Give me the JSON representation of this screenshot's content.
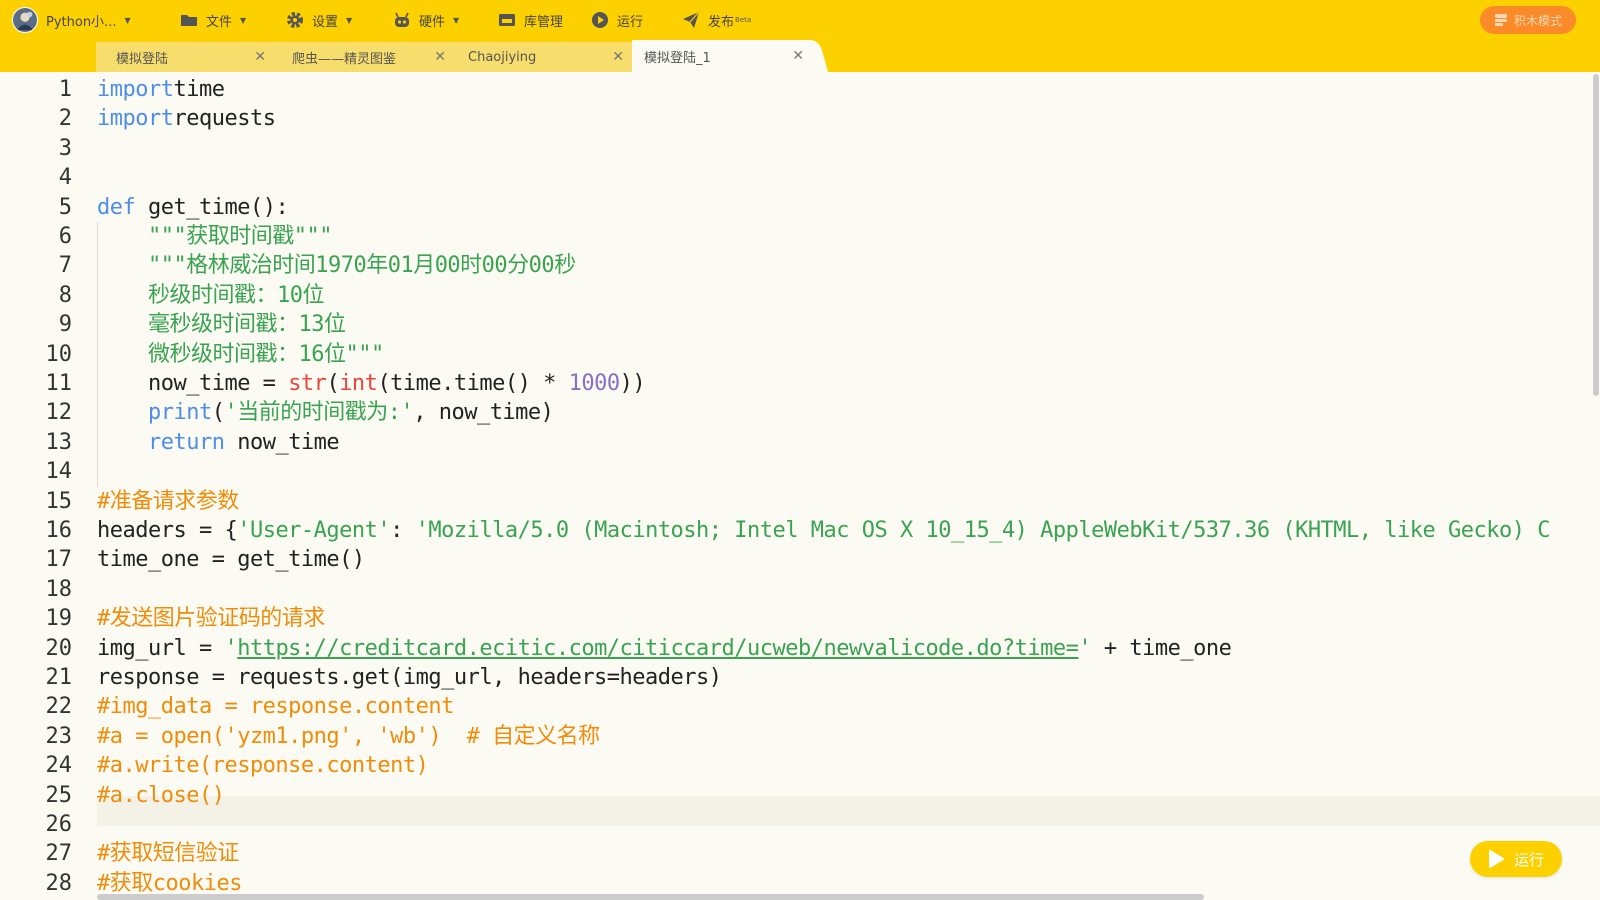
{
  "toolbar": {
    "project_label": "Python小...",
    "file_label": "文件",
    "settings_label": "设置",
    "hardware_label": "硬件",
    "library_label": "库管理",
    "run_label": "运行",
    "publish_label": "发布",
    "publish_badge": "Beta",
    "block_mode_label": "积木模式"
  },
  "tabs": [
    {
      "label": "模拟登陆",
      "active": false
    },
    {
      "label": "爬虫——精灵图鉴",
      "active": false
    },
    {
      "label": "Chaojiying",
      "active": false
    },
    {
      "label": "模拟登陆_1",
      "active": true
    }
  ],
  "editor": {
    "highlighted_line": 25,
    "line_numbers": [
      "1",
      "2",
      "3",
      "4",
      "5",
      "6",
      "7",
      "8",
      "9",
      "10",
      "11",
      "12",
      "13",
      "14",
      "15",
      "16",
      "17",
      "18",
      "19",
      "20",
      "21",
      "22",
      "23",
      "24",
      "25",
      "26",
      "27",
      "28"
    ],
    "lines": [
      [
        [
          "kw",
          "import"
        ],
        [
          "",
          "time"
        ]
      ],
      [
        [
          "kw",
          "import"
        ],
        [
          "",
          "requests"
        ]
      ],
      [],
      [],
      [
        [
          "kw",
          "def"
        ],
        [
          "",
          " get_time():"
        ]
      ],
      [
        [
          "",
          "    "
        ],
        [
          "str",
          "\"\"\"获取时间戳\"\"\""
        ]
      ],
      [
        [
          "",
          "    "
        ],
        [
          "str",
          "\"\"\"格林威治时间1970年01月00时00分00秒"
        ]
      ],
      [
        [
          "",
          "    "
        ],
        [
          "str",
          "秒级时间戳：10位"
        ]
      ],
      [
        [
          "",
          "    "
        ],
        [
          "str",
          "毫秒级时间戳：13位"
        ]
      ],
      [
        [
          "",
          "    "
        ],
        [
          "str",
          "微秒级时间戳：16位\"\"\""
        ]
      ],
      [
        [
          "",
          "    now_time = "
        ],
        [
          "fn",
          "str"
        ],
        [
          "",
          "("
        ],
        [
          "fn",
          "int"
        ],
        [
          "",
          "(time.time() * "
        ],
        [
          "num",
          "1000"
        ],
        [
          "",
          "))"
        ]
      ],
      [
        [
          "",
          "    "
        ],
        [
          "kw",
          "print"
        ],
        [
          "",
          "("
        ],
        [
          "str",
          "'当前的时间戳为:'"
        ],
        [
          "",
          ", now_time)"
        ]
      ],
      [
        [
          "",
          "    "
        ],
        [
          "kw",
          "return"
        ],
        [
          "",
          " now_time"
        ]
      ],
      [],
      [
        [
          "cm",
          "#准备请求参数"
        ]
      ],
      [
        [
          "",
          "headers = {"
        ],
        [
          "str",
          "'User-Agent'"
        ],
        [
          "",
          ": "
        ],
        [
          "str",
          "'Mozilla/5.0 (Macintosh; Intel Mac OS X 10_15_4) AppleWebKit/537.36 (KHTML, like Gecko) C"
        ]
      ],
      [
        [
          "",
          "time_one = get_time()"
        ]
      ],
      [],
      [
        [
          "cm",
          "#发送图片验证码的请求"
        ]
      ],
      [
        [
          "",
          "img_url = "
        ],
        [
          "str",
          "'"
        ],
        [
          "url",
          "https://creditcard.ecitic.com/citiccard/ucweb/newvalicode.do?time="
        ],
        [
          "str",
          "'"
        ],
        [
          "",
          " + time_one"
        ]
      ],
      [
        [
          "",
          "response = requests.get(img_url, headers=headers)"
        ]
      ],
      [
        [
          "cm",
          "#img_data = response.content"
        ]
      ],
      [
        [
          "cm",
          "#a = open('yzm1.png', 'wb')  # 自定义名称"
        ]
      ],
      [
        [
          "cm",
          "#a.write(response.content)"
        ]
      ],
      [
        [
          "cm",
          "#a.close()"
        ]
      ],
      [],
      [
        [
          "cm",
          "#获取短信验证"
        ]
      ],
      [
        [
          "cm",
          "#获取cookies"
        ]
      ]
    ]
  },
  "run_button_label": "运行",
  "colors": {
    "toolbar_bg": "#fdd100",
    "editor_bg": "#fcfbf3",
    "keyword": "#4f8ee8",
    "builtin_fn": "#e8453c",
    "number": "#8770c8",
    "string": "#3aa352",
    "comment": "#f08c0a",
    "block_mode_bg": "#fb8b29"
  }
}
